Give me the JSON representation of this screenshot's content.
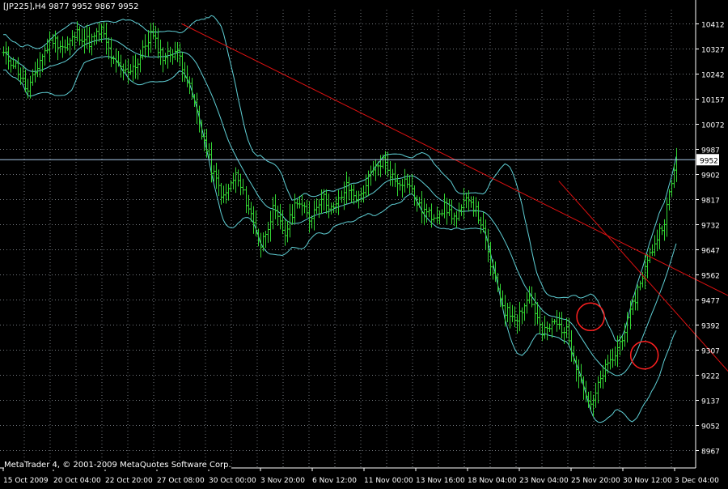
{
  "header": {
    "symbol": "[JP225],H4",
    "ohlc": "9877 9952 9867 9952"
  },
  "footer": {
    "copyright": "MetaTrader 4, © 2001-2009 MetaQuotes Software Corp."
  },
  "colors": {
    "background": "#000000",
    "grid": "#9aa0a8",
    "candles": "#33d633",
    "bands": "#5fcfd5",
    "trendlines": "#dd1111",
    "bid_line": "#a8c8e8",
    "markers": "#ff2020",
    "text": "#ffffff"
  },
  "chart_data": {
    "type": "bar",
    "timeframe": "H4",
    "ylim": [
      8940,
      10480
    ],
    "y_ticks": [
      10412,
      10327,
      10242,
      10157,
      10072,
      9987,
      9902,
      9817,
      9732,
      9647,
      9562,
      9477,
      9392,
      9307,
      9222,
      9137,
      9052,
      8967
    ],
    "x_tick_labels": [
      "15 Oct 2009",
      "20 Oct 04:00",
      "22 Oct 20:00",
      "27 Oct 08:00",
      "30 Oct 00:00",
      "3 Nov 20:00",
      "6 Nov 12:00",
      "11 Nov 00:00",
      "13 Nov 16:00",
      "18 Nov 04:00",
      "23 Nov 04:00",
      "25 Nov 20:00",
      "30 Nov 12:00",
      "3 Dec 04:00"
    ],
    "current_price": 9952,
    "current_price_label": "9952",
    "close_anchors": [
      [
        0,
        10310
      ],
      [
        5,
        10270
      ],
      [
        10,
        10180
      ],
      [
        15,
        10290
      ],
      [
        20,
        10360
      ],
      [
        25,
        10330
      ],
      [
        30,
        10380
      ],
      [
        35,
        10350
      ],
      [
        40,
        10390
      ],
      [
        45,
        10280
      ],
      [
        50,
        10250
      ],
      [
        55,
        10280
      ],
      [
        60,
        10380
      ],
      [
        65,
        10300
      ],
      [
        70,
        10320
      ],
      [
        72,
        10300
      ],
      [
        78,
        10140
      ],
      [
        85,
        9920
      ],
      [
        90,
        9820
      ],
      [
        95,
        9900
      ],
      [
        100,
        9790
      ],
      [
        105,
        9660
      ],
      [
        110,
        9780
      ],
      [
        115,
        9700
      ],
      [
        120,
        9820
      ],
      [
        125,
        9750
      ],
      [
        130,
        9830
      ],
      [
        135,
        9780
      ],
      [
        140,
        9860
      ],
      [
        145,
        9820
      ],
      [
        150,
        9900
      ],
      [
        155,
        9950
      ],
      [
        160,
        9880
      ],
      [
        165,
        9880
      ],
      [
        170,
        9790
      ],
      [
        175,
        9760
      ],
      [
        180,
        9790
      ],
      [
        185,
        9750
      ],
      [
        190,
        9830
      ],
      [
        195,
        9740
      ],
      [
        200,
        9560
      ],
      [
        205,
        9440
      ],
      [
        210,
        9420
      ],
      [
        215,
        9490
      ],
      [
        220,
        9360
      ],
      [
        225,
        9400
      ],
      [
        230,
        9370
      ],
      [
        235,
        9230
      ],
      [
        240,
        9110
      ],
      [
        245,
        9230
      ],
      [
        250,
        9290
      ],
      [
        255,
        9400
      ],
      [
        260,
        9540
      ],
      [
        265,
        9650
      ],
      [
        270,
        9750
      ],
      [
        275,
        9952
      ]
    ],
    "trendlines": [
      {
        "name": "",
        "from": [
          73,
          10412
        ],
        "to": [
          310,
          9435
        ]
      },
      {
        "name": "",
        "from": [
          227,
          9880
        ],
        "to": [
          310,
          9107
        ]
      }
    ],
    "highlight_circles": [
      {
        "at": [
          240,
          9420
        ]
      },
      {
        "at": [
          262,
          9290
        ]
      }
    ]
  }
}
